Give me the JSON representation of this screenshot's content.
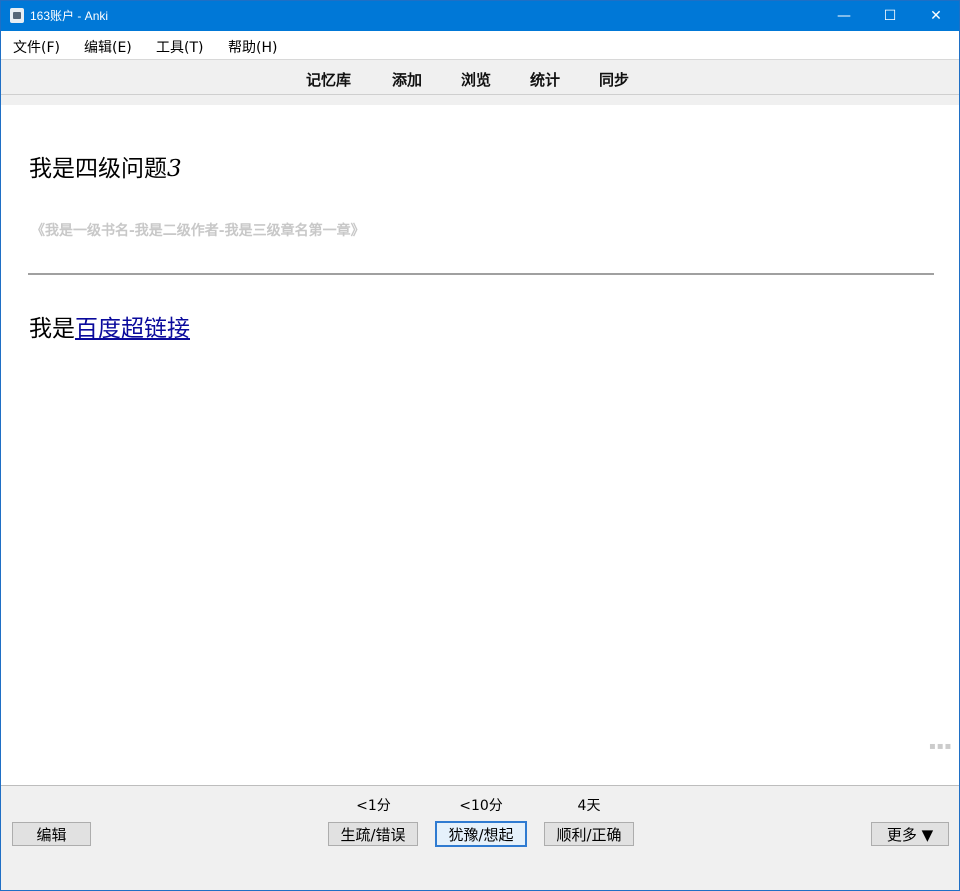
{
  "window": {
    "title": "163账户 - Anki"
  },
  "controls": {
    "minimize": "—",
    "maximize": "☐",
    "close": "✕"
  },
  "menu": [
    "文件(F)",
    "编辑(E)",
    "工具(T)",
    "帮助(H)"
  ],
  "toolbar": [
    "记忆库",
    "添加",
    "浏览",
    "统计",
    "同步"
  ],
  "card": {
    "question_main": "我是四级问题",
    "question_num": "3",
    "source": "《我是一级书名-我是二级作者-我是三级章名第一章》",
    "answer_prefix": "我是",
    "answer_link": "百度超链接"
  },
  "bottom": {
    "edit": "编辑",
    "more": "更多 ▼",
    "answers": [
      {
        "interval": "<1分",
        "label": "生疏/错误"
      },
      {
        "interval": "<10分",
        "label": "犹豫/想起"
      },
      {
        "interval": "4天",
        "label": "顺利/正确"
      }
    ]
  },
  "colors": {
    "titlebar": "#0078d7",
    "link": "#0a0a9c",
    "focus": "#2f7bd1"
  }
}
